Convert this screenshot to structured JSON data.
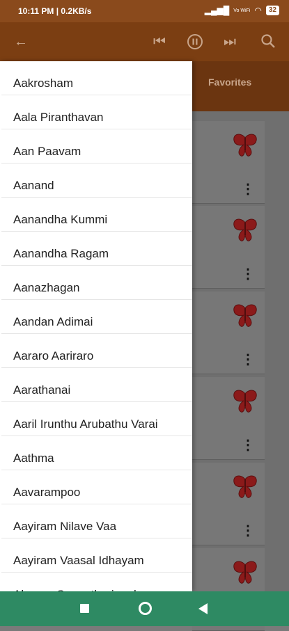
{
  "status_bar": {
    "time_speed": "10:11 PM | 0.2KB/s",
    "network_text": "Vo WiFi",
    "battery": "32"
  },
  "app_bar": {
    "back_icon": "arrow-left-icon",
    "prev_icon": "skip-previous-icon",
    "pause_icon": "pause-circle-icon",
    "next_icon": "skip-next-icon",
    "search_icon": "search-icon"
  },
  "tabs": {
    "favorites": "Favorites"
  },
  "drawer": {
    "items": [
      "Aakrosham",
      "Aala Piranthavan",
      "Aan Paavam",
      "Aanand",
      "Aanandha Kummi",
      "Aanandha Ragam",
      "Aanazhagan",
      "Aandan Adimai",
      "Aararo Aariraro",
      "Aarathanai",
      "Aaril Irunthu Arubathu Varai",
      "Aathma",
      "Aavarampoo",
      "Aayiram Nilave Vaa",
      "Aayiram Vaasal Idhayam",
      "Abaaya Sangathariggal"
    ]
  },
  "cards": {
    "menu_glyph": "⋮",
    "icon": "butterfly-icon"
  },
  "colors": {
    "appbar": "#7b3e12",
    "statusbar": "#8a4a1c",
    "navbar": "#2e8a63",
    "butterfly": "#8b1a1a"
  }
}
